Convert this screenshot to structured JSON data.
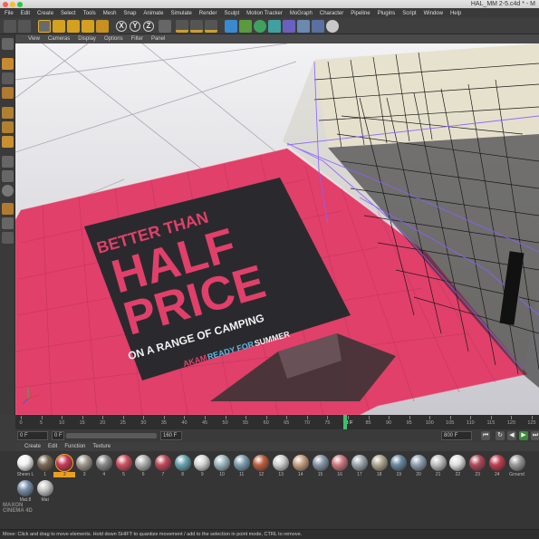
{
  "window": {
    "title": "HAL_MM 2-5.c4d * - M"
  },
  "menubar": {
    "items": [
      "File",
      "Edit",
      "Create",
      "Select",
      "Tools",
      "Mesh",
      "Snap",
      "Animate",
      "Simulate",
      "Render",
      "Sculpt",
      "Motion Tracker",
      "MoGraph",
      "Character",
      "Pipeline",
      "Plugins",
      "Script",
      "Window",
      "Help"
    ]
  },
  "toolbar": {
    "axis_x": "X",
    "axis_y": "Y",
    "axis_z": "Z"
  },
  "viewport": {
    "menu": [
      "View",
      "Cameras",
      "Display",
      "Options",
      "Filter",
      "Panel"
    ],
    "poster": {
      "line1": "BETTER THAN",
      "line2": "HALF",
      "line3": "PRICE",
      "line4": "ON A RANGE OF CAMPING",
      "line5_a": "AKAM",
      "line5_b": "READY FOR",
      "line5_c": "SUMMER"
    }
  },
  "timeline": {
    "ticks": [
      "0",
      "5",
      "10",
      "15",
      "20",
      "25",
      "30",
      "35",
      "40",
      "45",
      "50",
      "55",
      "60",
      "65",
      "70",
      "75",
      "78 F",
      "85",
      "90",
      "95",
      "100",
      "105",
      "110",
      "115",
      "120",
      "125"
    ],
    "current_frame": "78 F"
  },
  "transport": {
    "start_field": "0 F",
    "preview_min": "0 F",
    "preview_max": "160 F",
    "end_field": "800 F"
  },
  "materials": {
    "menu": [
      "Create",
      "Edit",
      "Function",
      "Texture"
    ],
    "items": [
      {
        "label": "Sheen L",
        "color": "#f2f2f2"
      },
      {
        "label": "1",
        "color": "#7a6a55"
      },
      {
        "label": "2",
        "color": "#c83a5a"
      },
      {
        "label": "3",
        "color": "#a09890"
      },
      {
        "label": "4",
        "color": "#8a8a8a"
      },
      {
        "label": "5",
        "color": "#d05060"
      },
      {
        "label": "6",
        "color": "#b0b0b0"
      },
      {
        "label": "7",
        "color": "#c04a5a"
      },
      {
        "label": "8",
        "color": "#6aa5b0"
      },
      {
        "label": "9",
        "color": "#d8d8d8"
      },
      {
        "label": "10",
        "color": "#9fb8c0"
      },
      {
        "label": "11",
        "color": "#7fa0b0"
      },
      {
        "label": "12",
        "color": "#c06040"
      },
      {
        "label": "13",
        "color": "#d0d0d0"
      },
      {
        "label": "14",
        "color": "#c8a080"
      },
      {
        "label": "15",
        "color": "#8898a8"
      },
      {
        "label": "16",
        "color": "#d07a80"
      },
      {
        "label": "17",
        "color": "#a0a8b0"
      },
      {
        "label": "18",
        "color": "#b0a890"
      },
      {
        "label": "19",
        "color": "#6a8aa0"
      },
      {
        "label": "20",
        "color": "#90a0b0"
      },
      {
        "label": "21",
        "color": "#c0c0c0"
      },
      {
        "label": "22",
        "color": "#e0e0e0"
      },
      {
        "label": "23",
        "color": "#b04a5a"
      },
      {
        "label": "24",
        "color": "#c04050"
      },
      {
        "label": "Ground",
        "color": "#9a9a9a"
      },
      {
        "label": "Mat.8",
        "color": "#7890a8"
      },
      {
        "label": "Mat",
        "color": "#c8c8c8"
      }
    ]
  },
  "status": {
    "text": "Move: Click and drag to move elements. Hold down SHIFT to quantize movement / add to the selection in point mode, CTRL to remove."
  },
  "branding": {
    "logo_line1": "MAXON",
    "logo_line2": "CINEMA 4D"
  }
}
